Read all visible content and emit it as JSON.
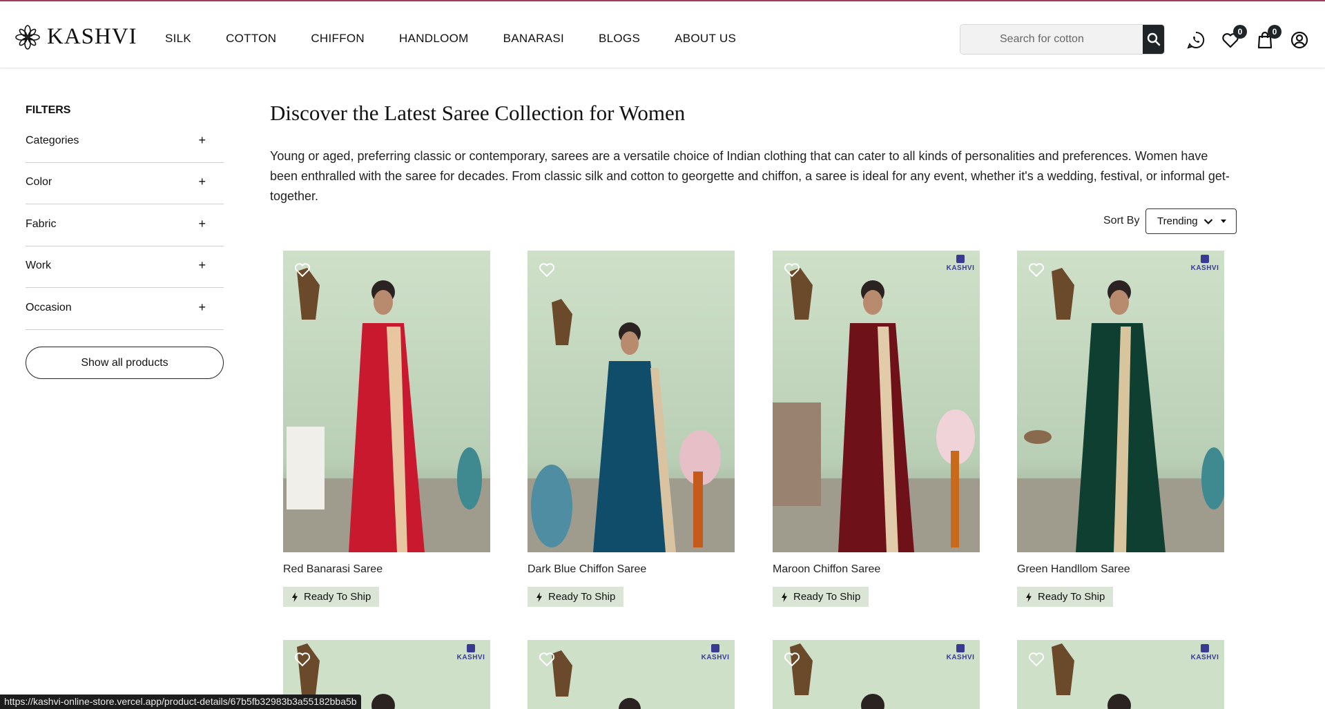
{
  "brand": {
    "name": "KASHVI"
  },
  "nav": [
    "SILK",
    "COTTON",
    "CHIFFON",
    "HANDLOOM",
    "BANARASI",
    "BLOGS",
    "ABOUT US"
  ],
  "search": {
    "placeholder": "Search for cotton",
    "value": ""
  },
  "header": {
    "wishlist_count": "0",
    "cart_count": "0"
  },
  "sidebar": {
    "title": "FILTERS",
    "filters": [
      {
        "label": "Categories",
        "toggle": "+"
      },
      {
        "label": "Color",
        "toggle": "+"
      },
      {
        "label": "Fabric",
        "toggle": "+"
      },
      {
        "label": "Work",
        "toggle": "+"
      },
      {
        "label": "Occasion",
        "toggle": "+"
      }
    ],
    "show_all": "Show all products"
  },
  "main": {
    "title": "Discover the Latest Saree Collection for Women",
    "intro": "Young or aged, preferring classic or contemporary, sarees are a versatile choice of Indian clothing that can cater to all kinds of personalities and preferences. Women have been enthralled with the saree for decades. From classic silk and cotton to georgette and chiffon, a saree is ideal for any event, whether it's a wedding, festival, or informal get-together.",
    "sort_label": "Sort By",
    "sort_value": "Trending"
  },
  "products": [
    {
      "name": "Red Banarasi Saree",
      "badge": "Ready To Ship",
      "saree_color": "#c8192e",
      "accent": "#e8c7a0"
    },
    {
      "name": "Dark Blue Chiffon Saree",
      "badge": "Ready To Ship",
      "saree_color": "#0f4d6a",
      "accent": "#d9c3a0"
    },
    {
      "name": "Maroon Chiffon Saree",
      "badge": "Ready To Ship",
      "saree_color": "#6e1119",
      "accent": "#e2cba8"
    },
    {
      "name": "Green Handllom Saree",
      "badge": "Ready To Ship",
      "saree_color": "#0f3f30",
      "accent": "#d8c59e"
    }
  ],
  "products_row2": [
    {
      "saree_color": "#2e6b8a"
    },
    {
      "saree_color": "#a71d2f"
    },
    {
      "saree_color": "#1d4f74"
    },
    {
      "saree_color": "#0f4a3a"
    }
  ],
  "brand_overlay": "KASHVI",
  "statusbar": {
    "url": "https://kashvi-online-store.vercel.app/product-details/67b5fb32983b3a55182bba5b"
  }
}
